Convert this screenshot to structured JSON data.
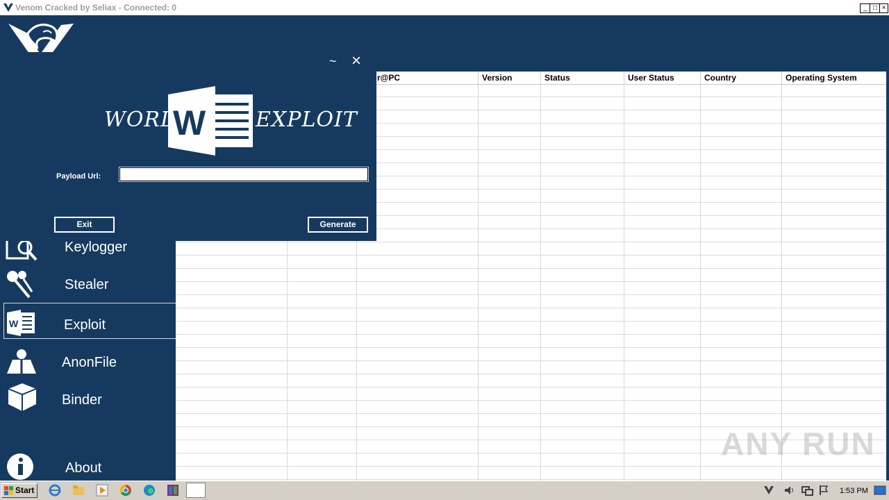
{
  "window": {
    "title": "Venom Cracked by Seliax - Connected: 0",
    "minimize_glyph": "_",
    "maximize_glyph": "□",
    "close_glyph": "×"
  },
  "grid": {
    "columns": [
      "r@PC",
      "Version",
      "Status",
      "User Status",
      "Country",
      "Operating System"
    ]
  },
  "sidebar": {
    "items": [
      {
        "label": "",
        "icon": "computer-icon"
      },
      {
        "label": "",
        "icon": "settings-gears-icon"
      },
      {
        "label": "",
        "icon": "user-check-icon"
      },
      {
        "label": "Keylogger",
        "icon": "keylogger-icon"
      },
      {
        "label": "Stealer",
        "icon": "keys-icon"
      },
      {
        "label": "Exploit",
        "icon": "word-icon"
      },
      {
        "label": "AnonFile",
        "icon": "anon-icon"
      },
      {
        "label": "Binder",
        "icon": "box-icon"
      },
      {
        "label": "About",
        "icon": "info-icon"
      }
    ]
  },
  "dialog": {
    "banner_left": "WORD",
    "banner_right": "EXPLOIT",
    "word_letter": "W",
    "minimize_glyph": "~",
    "close_glyph": "×",
    "payload_label": "Payload Url:",
    "payload_value": "",
    "exit_label": "Exit",
    "generate_label": "Generate"
  },
  "taskbar": {
    "start_label": "Start",
    "clock": "1:53 PM"
  },
  "watermark": "ANY RUN",
  "colors": {
    "panel": "#163a5f",
    "word_blue": "#2b579a"
  }
}
